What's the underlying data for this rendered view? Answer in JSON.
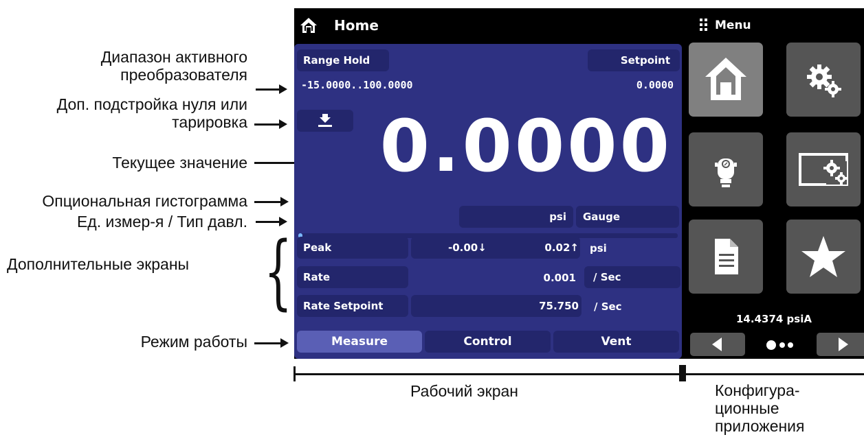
{
  "annotations": {
    "range_line1": "Диапазон активного",
    "range_line2": "преобразователя",
    "zero_line1": "Доп. подстройка нуля или",
    "zero_line2": "тарировка",
    "current_value": "Текущее значение",
    "bargraph": "Опциональная гистограмма",
    "units": "Ед. измер-я / Тип давл.",
    "extra_screens": "Дополнительные экраны",
    "mode": "Режим работы",
    "work_screen": "Рабочий экран",
    "config_line1": "Конфигура-",
    "config_line2": "ционные",
    "config_line3": "приложения"
  },
  "device": {
    "header": {
      "home_title": "Home",
      "menu_title": "Menu"
    },
    "range_hold_label": "Range Hold",
    "range_value": "-15.0000..100.0000",
    "setpoint_label": "Setpoint",
    "setpoint_value": "0.0000",
    "main_value": "0.0000",
    "bar_fill_fraction": 0.01,
    "unit": "psi",
    "pressure_type": "Gauge",
    "rows": [
      {
        "label": "Peak",
        "min": "-0.00↓",
        "value": "0.02↑",
        "unit": "psi"
      },
      {
        "label": "Rate",
        "value": "0.001",
        "unit": "/ Sec"
      },
      {
        "label": "Rate Setpoint",
        "value": "75.750",
        "unit": "/ Sec"
      }
    ],
    "modes": [
      "Measure",
      "Control",
      "Vent"
    ],
    "active_mode": "Measure",
    "apps": [
      "home-icon",
      "gears-icon",
      "transducer-icon",
      "display-settings-icon",
      "document-icon",
      "star-icon"
    ],
    "barometer": "14.4374 psiA",
    "colors": {
      "panel": "#2e3182",
      "chip": "#23266c",
      "active_mode": "#5a5fb5",
      "tile": "#555555",
      "tile_selected": "#808080",
      "bar_fill": "#7ab7ff"
    }
  }
}
